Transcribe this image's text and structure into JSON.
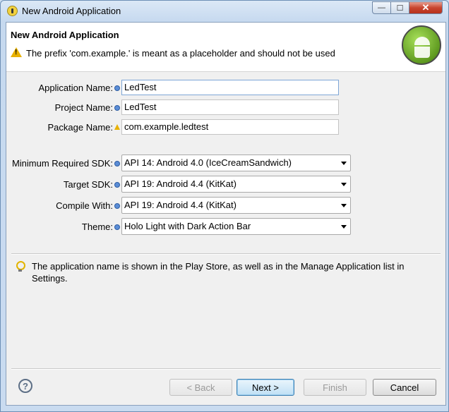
{
  "window": {
    "title": "New Android Application",
    "controls": {
      "minimize": "—",
      "maximize": "☐",
      "close": "✕"
    }
  },
  "header": {
    "title": "New Android Application",
    "message": "The prefix 'com.example.' is meant as a placeholder and should not be used"
  },
  "form": {
    "application_name": {
      "label": "Application Name:",
      "value": "LedTest"
    },
    "project_name": {
      "label": "Project Name:",
      "value": "LedTest"
    },
    "package_name": {
      "label": "Package Name:",
      "value": "com.example.ledtest"
    },
    "min_sdk": {
      "label": "Minimum Required SDK:",
      "value": "API 14: Android 4.0 (IceCreamSandwich)"
    },
    "target_sdk": {
      "label": "Target SDK:",
      "value": "API 19: Android 4.4 (KitKat)"
    },
    "compile_with": {
      "label": "Compile With:",
      "value": "API 19: Android 4.4 (KitKat)"
    },
    "theme": {
      "label": "Theme:",
      "value": "Holo Light with Dark Action Bar"
    }
  },
  "hint": "The application name is shown in the Play Store, as well as in the Manage Application list in Settings.",
  "buttons": {
    "help": "?",
    "back": "< Back",
    "next": "Next >",
    "finish": "Finish",
    "cancel": "Cancel"
  }
}
